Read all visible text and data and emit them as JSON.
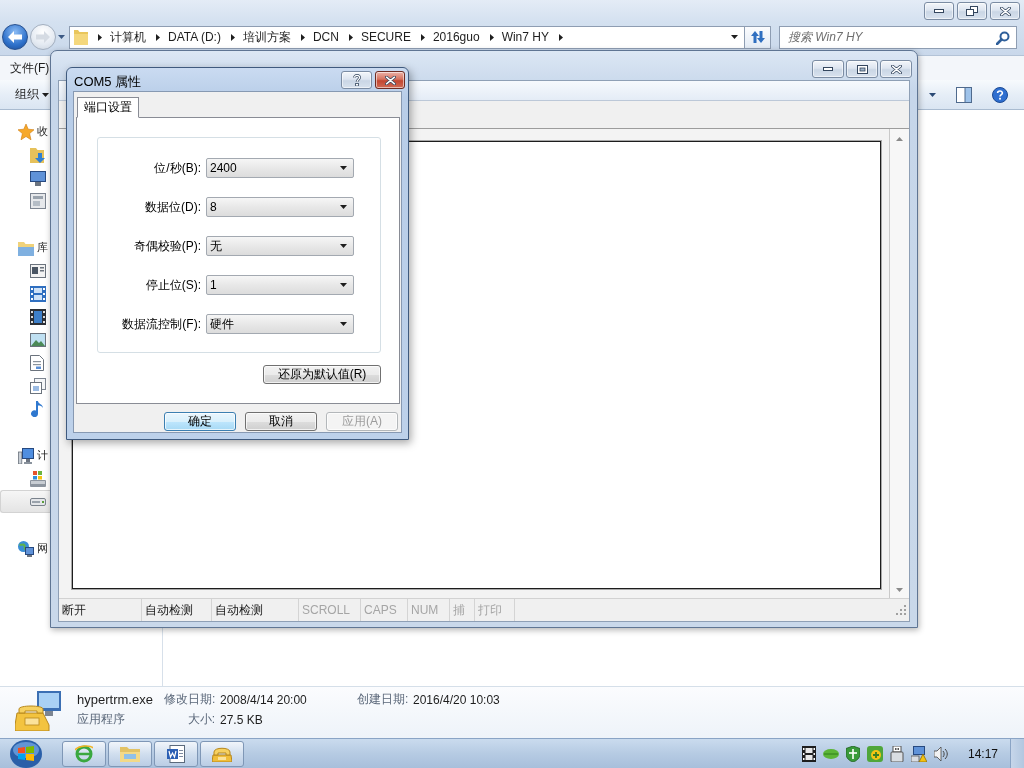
{
  "explorer": {
    "navigation": {
      "back": {
        "disabled": false
      },
      "forward": {
        "disabled": true
      }
    },
    "address": {
      "path": [
        "计算机",
        "DATA (D:)",
        "培训方案",
        "DCN",
        "SECURE",
        "2016guo",
        "Win7 HY"
      ]
    },
    "search": {
      "placeholder": "搜索 Win7 HY"
    },
    "menu": [
      "文件(F)"
    ],
    "toolbar": {
      "organize": "组织"
    },
    "nav": [
      {
        "kind": "favorites",
        "label": "收",
        "selected": false,
        "children": [
          {
            "kind": "downloads",
            "selected": false
          },
          {
            "kind": "desktop",
            "selected": false
          },
          {
            "kind": "recent",
            "selected": false
          }
        ]
      },
      {
        "kind": "libraries",
        "label": "库",
        "selected": false,
        "children": [
          {
            "kind": "library",
            "selected": false
          },
          {
            "kind": "videos",
            "selected": false
          },
          {
            "kind": "film",
            "selected": false
          },
          {
            "kind": "pictures",
            "selected": false
          },
          {
            "kind": "documents",
            "selected": false
          },
          {
            "kind": "files",
            "selected": false
          },
          {
            "kind": "music",
            "selected": false
          }
        ]
      },
      {
        "kind": "computer",
        "label": "计",
        "selected": false,
        "children": [
          {
            "kind": "system-drive",
            "selected": false
          },
          {
            "kind": "drive",
            "selected": true
          }
        ]
      },
      {
        "kind": "network",
        "label": "网",
        "selected": false
      }
    ],
    "details": {
      "name": "hypertrm.exe",
      "type": "应用程序",
      "properties": [
        {
          "label": "修改日期:",
          "value": "2008/4/14 20:00"
        },
        {
          "label": "创建日期:",
          "value": "2016/4/20 10:03"
        },
        {
          "label": "大小:",
          "value": "27.5 KB"
        }
      ]
    }
  },
  "terminal": {
    "status_bar": [
      {
        "text": "断开",
        "disabled": false
      },
      {
        "text": "自动检测",
        "disabled": false
      },
      {
        "text": "自动检测",
        "disabled": false
      },
      {
        "text": "SCROLL",
        "disabled": true
      },
      {
        "text": "CAPS",
        "disabled": true
      },
      {
        "text": "NUM",
        "disabled": true
      },
      {
        "text": "捕",
        "disabled": true
      },
      {
        "text": "打印",
        "disabled": true
      }
    ]
  },
  "dialog": {
    "title": "COM5 属性",
    "tabs": [
      {
        "label": "端口设置",
        "selected": true
      }
    ],
    "settings": [
      {
        "label": "位/秒(B):",
        "value": "2400"
      },
      {
        "label": "数据位(D):",
        "value": "8"
      },
      {
        "label": "奇偶校验(P):",
        "value": "无"
      },
      {
        "label": "停止位(S):",
        "value": "1"
      },
      {
        "label": "数据流控制(F):",
        "value": "硬件"
      }
    ],
    "restore_button": "还原为默认值(R)",
    "buttons": [
      {
        "label": "确定",
        "default": true,
        "disabled": false
      },
      {
        "label": "取消",
        "default": false,
        "disabled": false
      },
      {
        "label": "应用(A)",
        "default": false,
        "disabled": true
      }
    ]
  },
  "taskbar": {
    "clock": "14:17"
  }
}
